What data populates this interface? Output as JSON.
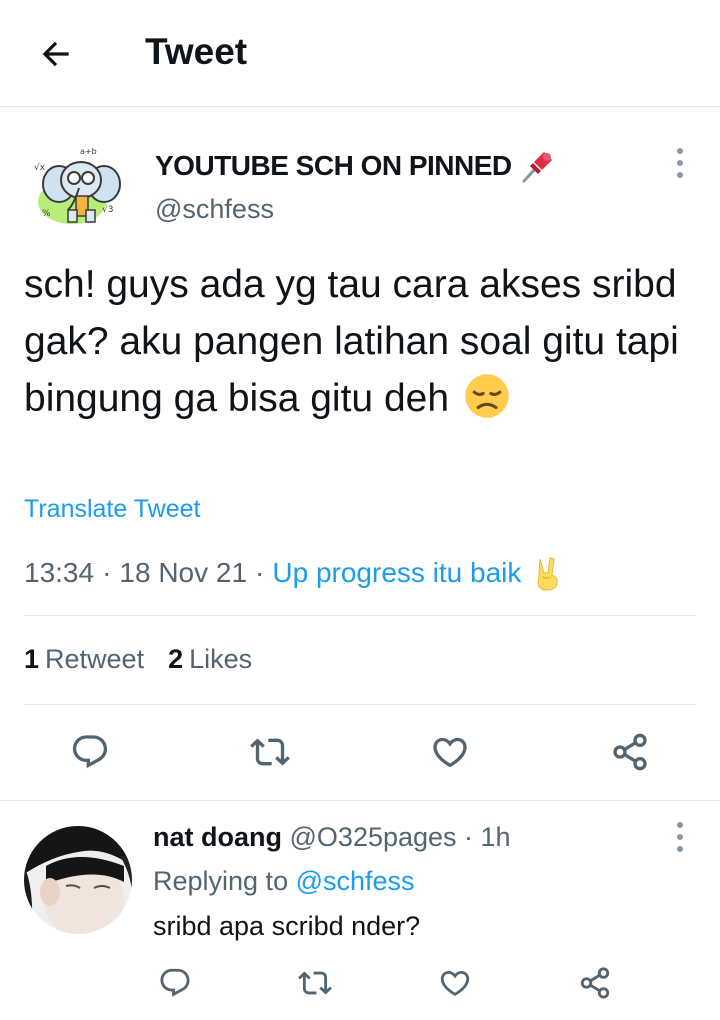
{
  "header": {
    "title": "Tweet"
  },
  "tweet": {
    "author_name": "YOUTUBE SCH ON PINNED",
    "author_handle": "@schfess",
    "text": "sch! guys ada yg tau cara akses sribd gak? aku pangen latihan soal gitu tapi bingung ga bisa gitu deh",
    "translate_label": "Translate Tweet",
    "time": "13:34",
    "date": "18 Nov 21",
    "source": "Up progress itu baik",
    "retweets_count": "1",
    "retweets_label": "Retweet",
    "likes_count": "2",
    "likes_label": "Likes",
    "icons": [
      "reply-icon",
      "retweet-icon",
      "like-icon",
      "share-icon"
    ]
  },
  "reply": {
    "name": "nat doang",
    "meta": "@O325pages · 1h",
    "replying_label": "Replying to",
    "replying_to": "@schfess",
    "text": "sribd apa scribd nder?"
  },
  "colors": {
    "accent": "#1d9bf0",
    "text_primary": "#0f1419",
    "text_secondary": "#536471",
    "divider": "#e1e6ea"
  }
}
